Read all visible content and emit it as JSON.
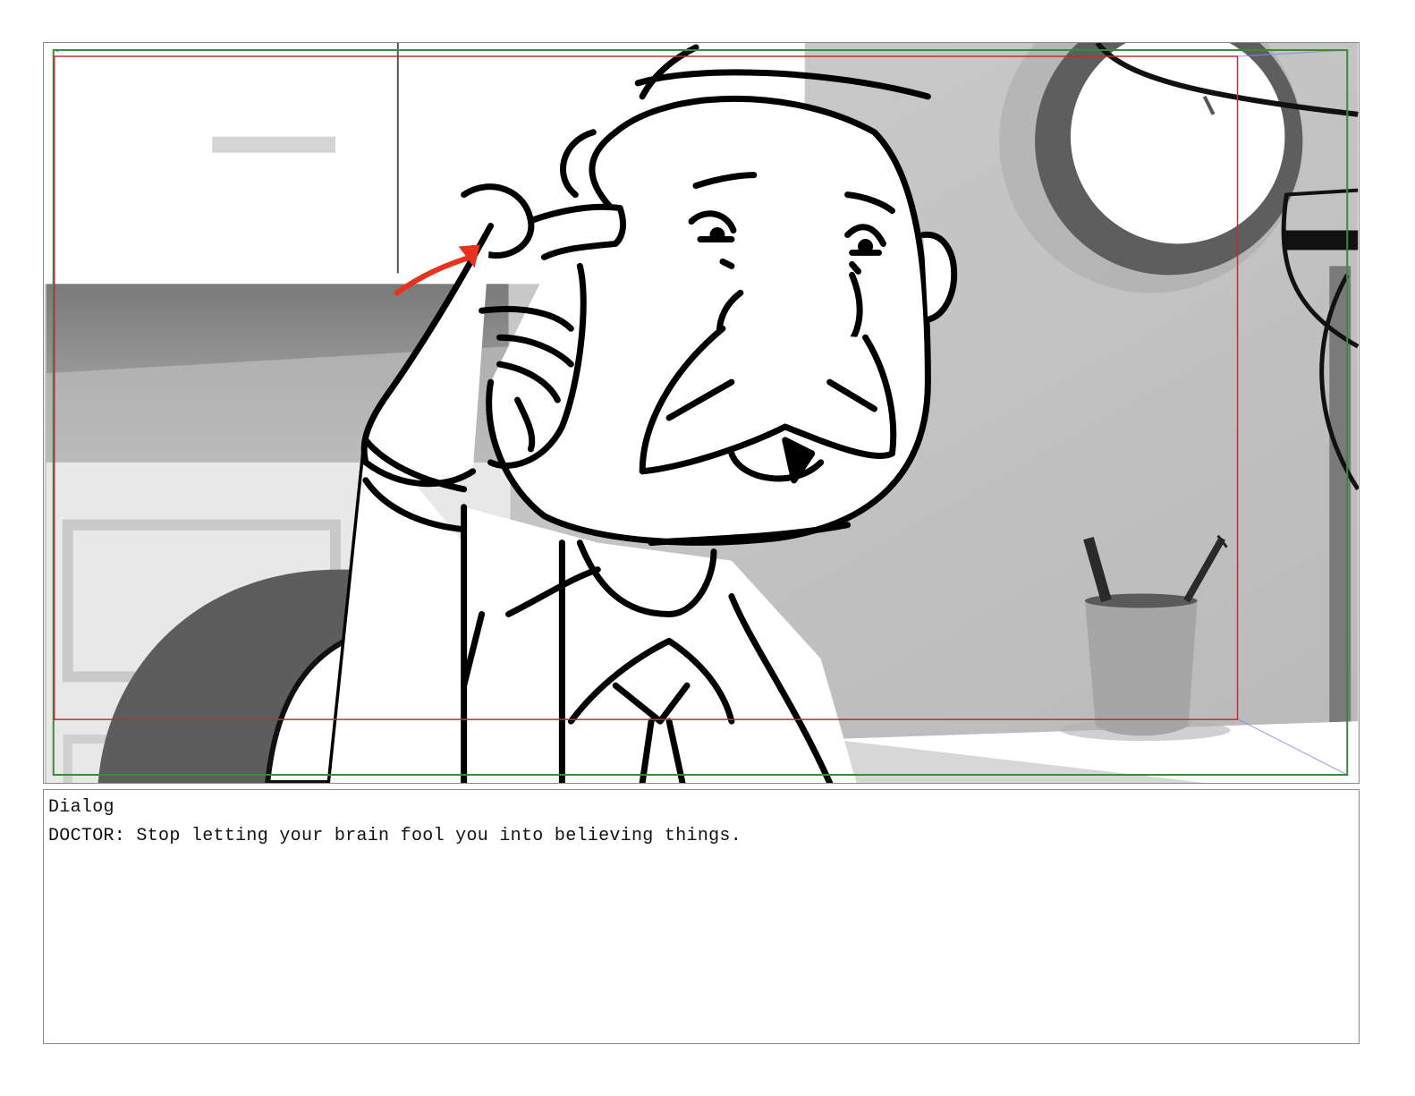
{
  "storyboard": {
    "panel": {
      "icon": "storyboard-panel-sketch",
      "colors": {
        "safe_area_outer": "#3a8a3a",
        "safe_area_inner": "#b83232",
        "annotation_arrow": "#e8321e",
        "perspective_guide": "#8a8ae6"
      }
    },
    "dialog": {
      "heading": "Dialog",
      "line": "DOCTOR: Stop letting your brain fool you into believing things."
    }
  }
}
